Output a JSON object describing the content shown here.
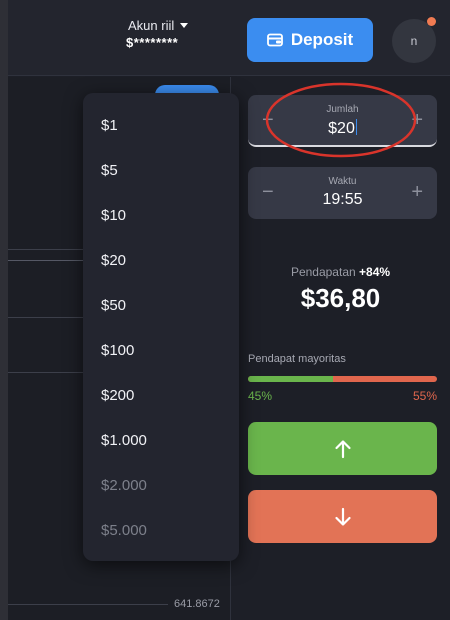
{
  "header": {
    "account_label": "Akun riil",
    "balance_masked": "$********",
    "deposit_label": "Deposit",
    "avatar_initial": "n"
  },
  "dropdown": {
    "items": [
      {
        "label": "$1",
        "enabled": true
      },
      {
        "label": "$5",
        "enabled": true
      },
      {
        "label": "$10",
        "enabled": true
      },
      {
        "label": "$20",
        "enabled": true
      },
      {
        "label": "$50",
        "enabled": true
      },
      {
        "label": "$100",
        "enabled": true
      },
      {
        "label": "$200",
        "enabled": true
      },
      {
        "label": "$1.000",
        "enabled": true
      },
      {
        "label": "$2.000",
        "enabled": false
      },
      {
        "label": "$5.000",
        "enabled": false
      }
    ]
  },
  "trade": {
    "amount_label": "Jumlah",
    "amount_value": "$20",
    "time_label": "Waktu",
    "time_value": "19:55",
    "minus_symbol": "−",
    "plus_symbol": "+",
    "payout_label": "Pendapatan",
    "payout_percent": "+84%",
    "payout_amount": "$36,80",
    "majority_label": "Pendapat mayoritas",
    "majority_up_pct": "45%",
    "majority_down_pct": "55%",
    "majority_up_fraction": 0.45
  },
  "chart": {
    "price_label": "641.8672"
  },
  "colors": {
    "accent_blue": "#3b8df0",
    "up_green": "#6ab54c",
    "down_red": "#e27356",
    "highlight_ellipse": "#d9342b"
  },
  "icons": {
    "deposit": "wallet-icon",
    "up": "arrow-up-icon",
    "down": "arrow-down-icon",
    "account": "chevron-down-icon"
  }
}
